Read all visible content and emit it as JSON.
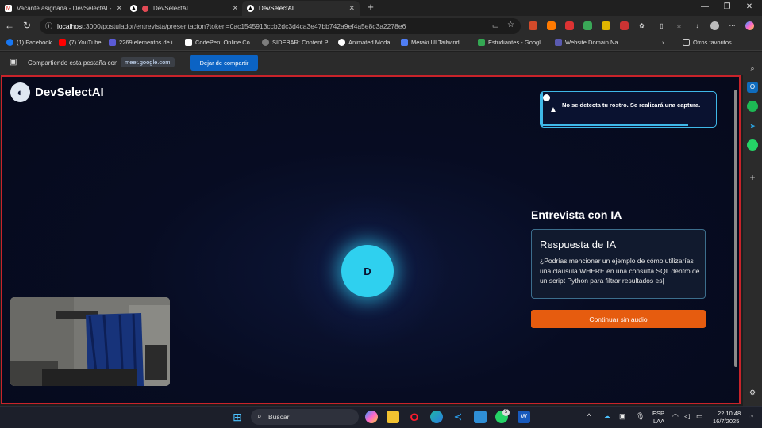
{
  "tabs": [
    {
      "label": "Vacante asignada - DevSelectAI - ",
      "icon": "gmail-icon",
      "active": false
    },
    {
      "label": "DevSelectAI",
      "icon": "recording-icon",
      "active": true
    },
    {
      "label": "DevSelectAI",
      "icon": "devselectai-icon",
      "active": false
    }
  ],
  "new_tab_label": "+",
  "address_bar": {
    "url_host": "localhost",
    "url_rest": ":3000/postulador/entrevista/presentacion?token=0ac1545913ccb2dc3d4ca3e47bb742a9ef4a5e8c3a2278e6"
  },
  "bookmarks": [
    {
      "label": "(1) Facebook",
      "color": "#1877f2"
    },
    {
      "label": "(7) YouTube",
      "color": "#ff0000"
    },
    {
      "label": "2269 elementos de i...",
      "color": "#5b5bd6"
    },
    {
      "label": "CodePen: Online Co...",
      "color": "#ffffff"
    },
    {
      "label": "SIDEBAR: Content P...",
      "color": "#7d7d7d"
    },
    {
      "label": "Animated Modal",
      "color": "#ffffff"
    },
    {
      "label": "Meraki UI Tailwind...",
      "color": "#4f7df3"
    },
    {
      "label": "Estudiantes - Googl...",
      "color": "#34a853"
    },
    {
      "label": "Website Domain Na...",
      "color": "#5a5ab0"
    }
  ],
  "bookmarks_overflow": "Otros favoritos",
  "share_bar": {
    "text": "Compartiendo esta pestaña con",
    "site": "meet.google.com",
    "stop_button": "Dejar de compartir"
  },
  "app": {
    "logo_text": "DevSelectAI",
    "toast": {
      "message": "No se detecta tu rostro. Se realizará una captura.",
      "progress": 0.84
    },
    "avatar_letter": "D",
    "interview_title": "Entrevista con IA",
    "ia_card": {
      "title": "Respuesta de IA",
      "body": "¿Podrías mencionar un ejemplo de cómo utilizarías una cláusula WHERE en una consulta SQL dentro de un script Python para filtrar resultados es|"
    },
    "continue_button": "Continuar sin audio"
  },
  "taskbar": {
    "search_label": "Buscar",
    "whatsapp_badge": "5",
    "language": "ESP",
    "language_region": "LAA",
    "time": "22:10:48",
    "date": "16/7/2025"
  },
  "colors": {
    "accent_cyan": "#2fd0ef",
    "button_orange": "#e65c0f",
    "page_border": "#c8232a",
    "share_blue": "#0b63c4"
  }
}
